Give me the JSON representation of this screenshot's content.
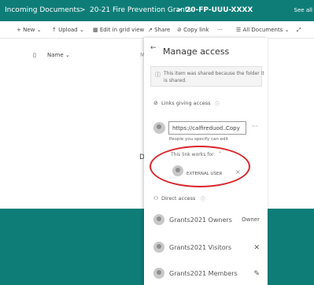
{
  "breadcrumb": {
    "items": [
      "Incoming Documents",
      "20-21 Fire Prevention Grants",
      "20-FP-UUU-XXXX"
    ],
    "separator": ">"
  },
  "header": {
    "see_all": "See all"
  },
  "toolbar": {
    "new": "New",
    "upload": "Upload",
    "edit_grid": "Edit in grid view",
    "share": "Share",
    "copy_link": "Copy link",
    "more": "···",
    "view": "All Documents"
  },
  "list": {
    "name_column": "Name",
    "truncated_text": "Di"
  },
  "panel": {
    "title": "Manage access",
    "info_text_line1": "This item was shared because the folder it",
    "info_text_line2": "is shared.",
    "links_giving_access": "Links giving access",
    "link_url": "https://calfireduod...",
    "copy_label": "Copy",
    "link_desc": "People you specify can edit",
    "link_works_for": "This link works for",
    "external_user": "EXTERNAL USER",
    "direct_access": "Direct access",
    "members": [
      {
        "name": "Grants2021 Owners",
        "perm": "Owner"
      },
      {
        "name": "Grants2021 Visitors",
        "perm": ""
      },
      {
        "name": "Grants2021 Members",
        "perm": ""
      }
    ]
  },
  "colors": {
    "teal": "#0e7d78",
    "highlight": "#d8262b"
  }
}
